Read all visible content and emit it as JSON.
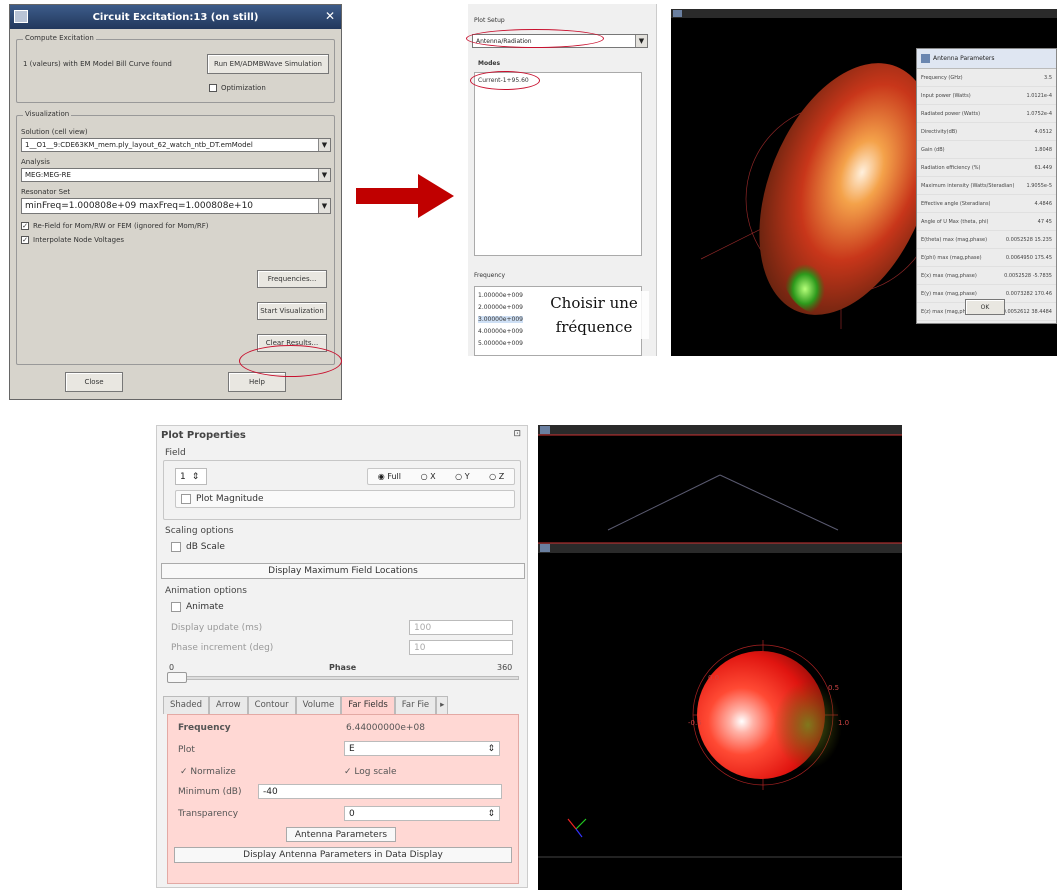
{
  "dialog": {
    "title": "Circuit Excitation:13 (on still)",
    "compute_group": "Compute Excitation",
    "compute_text": "1 (valeurs) with EM Model Bill Curve found",
    "run_button": "Run EM/ADMBWave Simulation",
    "optimization": "Optimization",
    "visualization_group": "Visualization",
    "solution_label": "Solution (cell view)",
    "solution_value": "1__O1__9:CDE63KM_mem.ply_layout_62_watch_ntb_DT.emModel",
    "analysis_label": "Analysis",
    "analysis_value": "MEG:MEG-RE",
    "resonator_label": "Resonator Set",
    "resonator_value": "minFreq=1.000808e+09 maxFreq=1.000808e+10",
    "check1": "Re-Field for Mom/RW or FEM (ignored for Mom/RF)",
    "check2": "Interpolate Node Voltages",
    "frequencies_button": "Frequencies...",
    "start_visu_button": "Start Visualization",
    "clear_results_button": "Clear Results...",
    "close_button": "Close",
    "help_button": "Help"
  },
  "panel2": {
    "plot_type_label": "Plot Setup",
    "plot_type_value": "Antenna/Radiation",
    "modes_label": "Modes",
    "modes_item": "Current-1+95.60",
    "freq_label": "Frequency",
    "frequencies": [
      "1.00000e+009",
      "2.00000e+009",
      "3.00000e+009",
      "4.00000e+009",
      "5.00000e+009"
    ],
    "note": "Choisir une fréquence",
    "ap_title": "Antenna Parameters",
    "ap_rows": [
      [
        "Frequency (GHz)",
        "3.5"
      ],
      [
        "Input power (Watts)",
        "1.0121e-4"
      ],
      [
        "Radiated power (Watts)",
        "1.0752e-4"
      ],
      [
        "Directivity(dB)",
        "4.0512"
      ],
      [
        "Gain (dB)",
        "1.8048"
      ],
      [
        "Radiation efficiency (%)",
        "61.449"
      ],
      [
        "Maximum intensity (Watts/Steradian)",
        "1.9055e-5"
      ],
      [
        "Effective angle (Steradians)",
        "4.4846"
      ],
      [
        "Angle of U Max (theta, phi)",
        "47    45"
      ],
      [
        "E(theta) max (mag,phase)",
        "0.0052528  15.235"
      ],
      [
        "E(phi) max (mag,phase)",
        "0.0064950  175.45"
      ],
      [
        "E(x) max (mag,phase)",
        "0.0052528  -5.7835"
      ],
      [
        "E(y) max (mag,phase)",
        "0.0073282  170.46"
      ],
      [
        "E(z) max (mag,phase)",
        "0.0052612  38.4484"
      ]
    ],
    "ap_ok": "OK"
  },
  "plot_properties": {
    "title": "Plot Properties",
    "field_label": "Field",
    "spinner": "1",
    "radio_full": "Full",
    "radio_x": "X",
    "radio_y": "Y",
    "radio_z": "Z",
    "plot_magnitude": "Plot Magnitude",
    "scaling_label": "Scaling options",
    "db_scale": "dB Scale",
    "display_max_button": "Display Maximum Field Locations",
    "animation_label": "Animation options",
    "animate": "Animate",
    "display_update_label": "Display update (ms)",
    "display_update_value": "100",
    "phase_increment_label": "Phase increment (deg)",
    "phase_increment_value": "10",
    "phase_min": "0",
    "phase_title": "Phase",
    "phase_max": "360",
    "phase_value": 0,
    "tabs": [
      "Shaded",
      "Arrow",
      "Contour",
      "Volume",
      "Far Fields",
      "Far Fie"
    ],
    "active_tab": "Far Fields",
    "frequency_label": "Frequency",
    "frequency_value": "6.44000000e+08",
    "plot_label": "Plot",
    "plot_value": "E",
    "normalize": "Normalize",
    "log_scale": "Log scale",
    "minimum_label": "Minimum (dB)",
    "minimum_value": "-40",
    "transparency_label": "Transparency",
    "transparency_value": "0",
    "antenna_params_button": "Antenna Parameters",
    "display_ap_button": "Display Antenna Parameters in Data Display"
  },
  "colors": {
    "highlight": "#c8102e",
    "arrow": "#c00000",
    "tab_active": "#ffd3d0"
  }
}
